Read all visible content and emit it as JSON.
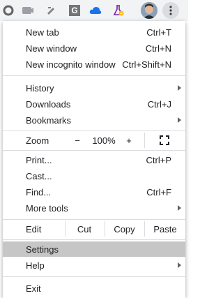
{
  "toolbar": {
    "extensions": [
      {
        "name": "circle-extension-icon"
      },
      {
        "name": "camera-extension-icon"
      },
      {
        "name": "pen-extension-icon"
      },
      {
        "name": "g-extension-icon",
        "letter": "G"
      },
      {
        "name": "cloud-extension-icon"
      },
      {
        "name": "flask-extension-icon"
      }
    ],
    "profile_icon": "avatar",
    "menu_icon": "three-dots-vertical-icon"
  },
  "menu": {
    "group1": [
      {
        "label": "New tab",
        "shortcut": "Ctrl+T"
      },
      {
        "label": "New window",
        "shortcut": "Ctrl+N"
      },
      {
        "label": "New incognito window",
        "shortcut": "Ctrl+Shift+N"
      }
    ],
    "group2": [
      {
        "label": "History",
        "submenu": true
      },
      {
        "label": "Downloads",
        "shortcut": "Ctrl+J"
      },
      {
        "label": "Bookmarks",
        "submenu": true
      }
    ],
    "zoom": {
      "label": "Zoom",
      "minus": "−",
      "value": "100%",
      "plus": "+",
      "fullscreen_icon": "fullscreen-icon"
    },
    "group3": [
      {
        "label": "Print...",
        "shortcut": "Ctrl+P"
      },
      {
        "label": "Cast..."
      },
      {
        "label": "Find...",
        "shortcut": "Ctrl+F"
      },
      {
        "label": "More tools",
        "submenu": true
      }
    ],
    "edit": {
      "label": "Edit",
      "cut": "Cut",
      "copy": "Copy",
      "paste": "Paste"
    },
    "group4": [
      {
        "label": "Settings",
        "highlighted": true
      },
      {
        "label": "Help",
        "submenu": true
      }
    ],
    "exit": {
      "label": "Exit"
    }
  },
  "colors": {
    "toolbar_bg": "#f1f3f4",
    "highlight": "#c6c6c6",
    "separator": "#dadce0"
  }
}
